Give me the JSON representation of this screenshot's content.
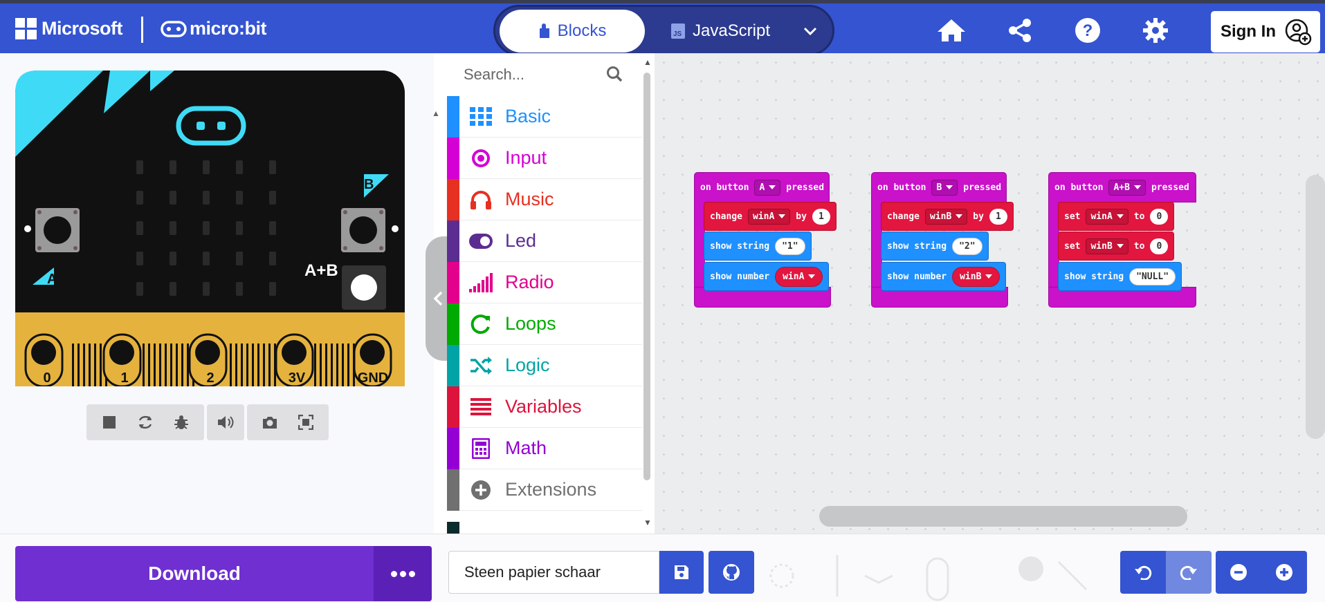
{
  "header": {
    "brand": "Microsoft",
    "product": "micro:bit",
    "tabs": [
      {
        "label": "Blocks",
        "icon": "puzzle-piece-icon",
        "active": true
      },
      {
        "label": "JavaScript",
        "icon": "js-file-icon",
        "active": false
      }
    ],
    "icons": [
      "home-icon",
      "share-icon",
      "help-icon",
      "settings-icon"
    ],
    "sign_in_label": "Sign In"
  },
  "simulator": {
    "pins": [
      "0",
      "1",
      "2",
      "3V",
      "GND"
    ],
    "button_a": "A",
    "button_b": "B",
    "button_ab": "A+B",
    "controls": [
      "stop-icon",
      "restart-icon",
      "debug-icon",
      "sound-icon",
      "screenshot-icon",
      "fullscreen-icon"
    ]
  },
  "toolbox": {
    "search_placeholder": "Search...",
    "categories": [
      {
        "label": "Basic",
        "color": "#1e90ff",
        "icon": "grid-icon"
      },
      {
        "label": "Input",
        "color": "#d400d4",
        "icon": "radio-button-icon"
      },
      {
        "label": "Music",
        "color": "#e63022",
        "icon": "headphones-icon"
      },
      {
        "label": "Led",
        "color": "#5c2d91",
        "icon": "toggle-icon"
      },
      {
        "label": "Radio",
        "color": "#e3008c",
        "icon": "signal-bars-icon"
      },
      {
        "label": "Loops",
        "color": "#00aa00",
        "icon": "refresh-icon"
      },
      {
        "label": "Logic",
        "color": "#00a4a6",
        "icon": "shuffle-icon"
      },
      {
        "label": "Variables",
        "color": "#dc143c",
        "icon": "list-icon"
      },
      {
        "label": "Math",
        "color": "#9400d3",
        "icon": "calculator-icon"
      },
      {
        "label": "Extensions",
        "color": "#707070",
        "icon": "plus-circle-icon"
      }
    ]
  },
  "workspace": {
    "events": [
      {
        "hat": [
          "on button",
          "A",
          "pressed"
        ],
        "s1": {
          "kw": "change",
          "var": "winA",
          "by": "by",
          "val": "1"
        },
        "s2": {
          "kw": "show string",
          "val": "1"
        },
        "s3": {
          "kw": "show number",
          "var": "winA"
        }
      },
      {
        "hat": [
          "on button",
          "B",
          "pressed"
        ],
        "s1": {
          "kw": "change",
          "var": "winB",
          "by": "by",
          "val": "1"
        },
        "s2": {
          "kw": "show string",
          "val": "2"
        },
        "s3": {
          "kw": "show number",
          "var": "winB"
        }
      },
      {
        "hat": [
          "on button",
          "A+B",
          "pressed"
        ],
        "s1": {
          "kw": "set",
          "var": "winA",
          "to": "to",
          "val": "0"
        },
        "s2": {
          "kw": "set",
          "var": "winB",
          "to": "to",
          "val": "0"
        },
        "s3": {
          "kw": "show string",
          "val": "NULL"
        }
      }
    ]
  },
  "footer": {
    "download_label": "Download",
    "project_name": "Steen papier schaar"
  }
}
